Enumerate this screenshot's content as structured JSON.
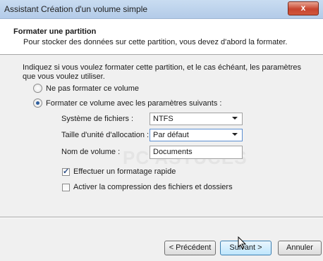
{
  "window": {
    "title": "Assistant Création d'un volume simple",
    "close_label": "x"
  },
  "header": {
    "title": "Formater une partition",
    "subtitle": "Pour stocker des données sur cette partition, vous devez d'abord la formater."
  },
  "content": {
    "intro": "Indiquez si vous voulez formater cette partition, et le cas échéant, les paramètres que vous voulez utiliser.",
    "radio_no_format": "Ne pas formater ce volume",
    "radio_format": "Formater ce volume avec les paramètres suivants :",
    "filesystem_label": "Système de fichiers :",
    "filesystem_value": "NTFS",
    "allocation_label": "Taille d'unité d'allocation :",
    "allocation_value": "Par défaut",
    "volume_name_label": "Nom de volume :",
    "volume_name_value": "Documents",
    "quick_format_label": "Effectuer un formatage rapide",
    "compression_label": "Activer la compression des fichiers et dossiers",
    "watermark": "PC ASTUCES"
  },
  "buttons": {
    "previous": "< Précédent",
    "next": "Suivant >",
    "cancel": "Annuler"
  }
}
